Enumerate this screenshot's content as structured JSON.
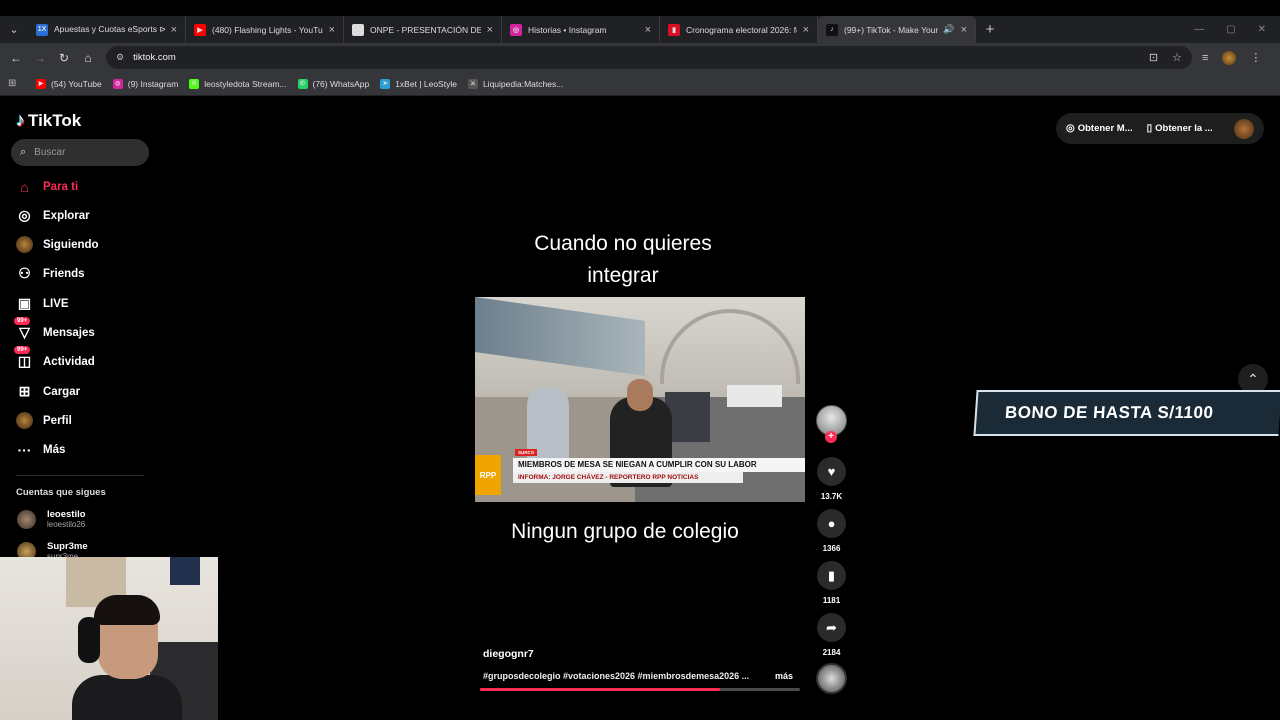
{
  "browser": {
    "tabs": [
      {
        "title": "Apuestas y Cuotas eSports ⊳ A",
        "icon": "1x-icon",
        "color": "#2a6fd6",
        "letter": "1X"
      },
      {
        "title": "(480) Flashing Lights - YouTube",
        "icon": "youtube-icon",
        "color": "#ff0000",
        "letter": "▶"
      },
      {
        "title": "ONPE - PRESENTACIÓN DE RE",
        "icon": "onpe-icon",
        "color": "#dddddd",
        "letter": "O"
      },
      {
        "title": "Historias • Instagram",
        "icon": "instagram-icon",
        "color": "#d6249f",
        "letter": "◎"
      },
      {
        "title": "Cronograma electoral 2026: fe",
        "icon": "flag-icon",
        "color": "#d91023",
        "letter": "▮"
      },
      {
        "title": "(99+) TikTok - Make Your Da",
        "icon": "tiktok-icon",
        "color": "#111111",
        "letter": "♪"
      }
    ],
    "url": "tiktok.com",
    "bookmarks": [
      {
        "label": "(54) YouTube",
        "color": "#ff0000",
        "letter": "▶"
      },
      {
        "label": "(9) Instagram",
        "color": "#d6249f",
        "letter": "◎"
      },
      {
        "label": "leostyledota Stream...",
        "color": "#53fc18",
        "letter": "K"
      },
      {
        "label": "(76) WhatsApp",
        "color": "#25d366",
        "letter": "✆"
      },
      {
        "label": "1xBet | LeoStyle",
        "color": "#2a9fd6",
        "letter": "➤"
      },
      {
        "label": "Liquipedia:Matches...",
        "color": "#555555",
        "letter": "⚔"
      }
    ]
  },
  "tiktok": {
    "brand": "TikTok",
    "search_placeholder": "Buscar",
    "nav": [
      {
        "label": "Para ti",
        "icon": "home-icon",
        "glyph": "⌂",
        "badge": ""
      },
      {
        "label": "Explorar",
        "icon": "compass-icon",
        "glyph": "◎",
        "badge": ""
      },
      {
        "label": "Siguiendo",
        "icon": "following-avatar-icon",
        "glyph": "●",
        "badge": ""
      },
      {
        "label": "Friends",
        "icon": "friends-icon",
        "glyph": "⚇",
        "badge": ""
      },
      {
        "label": "LIVE",
        "icon": "live-tv-icon",
        "glyph": "▣",
        "badge": ""
      },
      {
        "label": "Mensajes",
        "icon": "messages-icon",
        "glyph": "▽",
        "badge": "99+"
      },
      {
        "label": "Actividad",
        "icon": "activity-icon",
        "glyph": "◫",
        "badge": "99+"
      },
      {
        "label": "Cargar",
        "icon": "upload-icon",
        "glyph": "⊞",
        "badge": ""
      },
      {
        "label": "Perfil",
        "icon": "profile-icon",
        "glyph": "●",
        "badge": ""
      },
      {
        "label": "Más",
        "icon": "more-icon",
        "glyph": "···",
        "badge": ""
      }
    ],
    "following_title": "Cuentas que sigues",
    "following": [
      {
        "name": "leoestilo",
        "handle": "leoestilo26"
      },
      {
        "name": "Supr3me",
        "handle": "supr3me"
      }
    ],
    "top_actions": [
      "Obtener M...",
      "Obtener la ..."
    ],
    "video": {
      "caption_top": "Cuando no quieres integrar",
      "caption_bottom": "Ningun  grupo de colegio",
      "news_tag": "SURCO",
      "news_line1": "MIEMBROS DE MESA SE NIEGAN A CUMPLIR CON SU LABOR",
      "news_line2": "INFORMA: JORGE CHÁVEZ - REPORTERO RPP NOTICIAS",
      "news_logo": "RPP",
      "author": "diegognr7",
      "hashtags": "#gruposdecolegio #votaciones2026 #miembrosdemesa2026 ...",
      "more": "más",
      "progress": 0.75
    },
    "actions": [
      {
        "icon": "heart-icon",
        "glyph": "♥",
        "count": "13.7K"
      },
      {
        "icon": "comment-icon",
        "glyph": "●",
        "count": "1366"
      },
      {
        "icon": "bookmark-icon",
        "glyph": "▮",
        "count": "1181"
      },
      {
        "icon": "share-icon",
        "glyph": "➦",
        "count": "2184"
      }
    ],
    "promo": "BONO DE HASTA S/1100",
    "accent": "#fe2c55"
  }
}
